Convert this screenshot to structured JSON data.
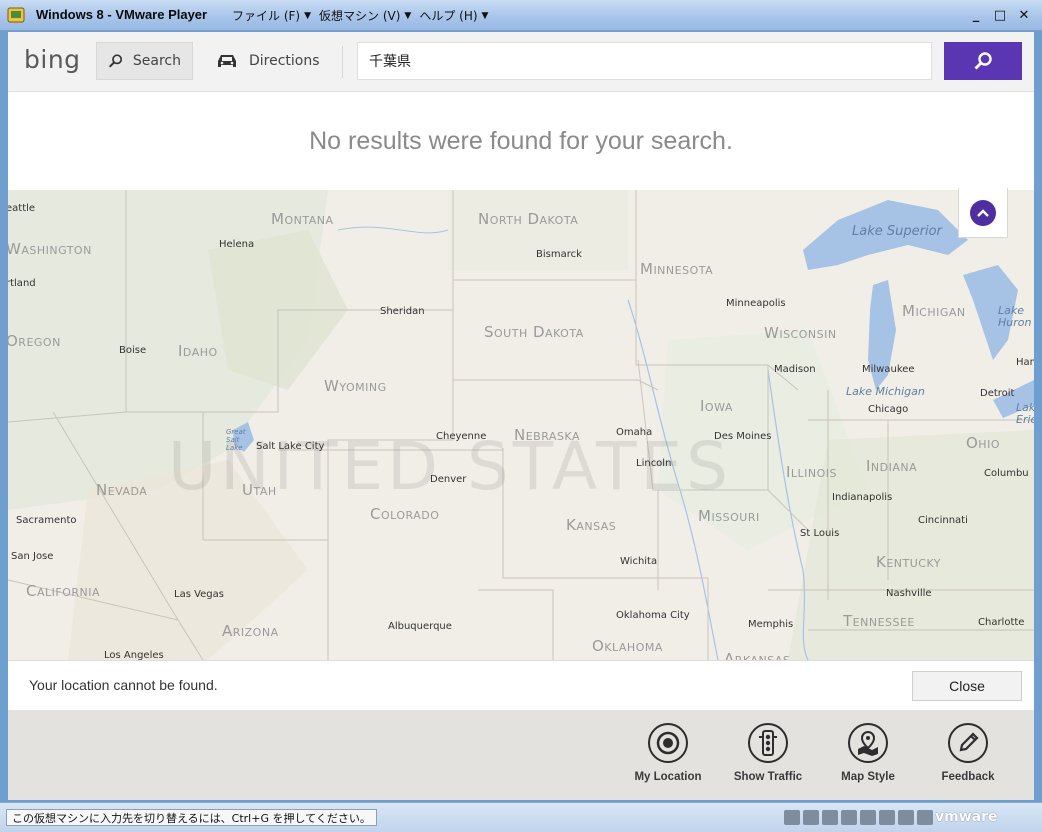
{
  "window": {
    "title": "Windows 8 - VMware Player",
    "menus": [
      "ファイル (F)",
      "仮想マシン (V)",
      "ヘルプ (H)"
    ],
    "controls": {
      "minimize": "_",
      "maximize": "□",
      "close": "✕"
    }
  },
  "app": {
    "logo": "bing",
    "tabs": {
      "search": "Search",
      "directions": "Directions"
    },
    "search": {
      "value": "千葉県",
      "button_icon": "search-icon"
    },
    "no_results": "No results were found for your search.",
    "map": {
      "country_label": "UNITED STATES",
      "states": [
        "Montana",
        "North Dakota",
        "Minnesota",
        "Washington",
        "Idaho",
        "Oregon",
        "South Dakota",
        "Wisconsin",
        "Michigan",
        "Wyoming",
        "Iowa",
        "Nebraska",
        "Nevada",
        "Utah",
        "Colorado",
        "Kansas",
        "Illinois",
        "Indiana",
        "Ohio",
        "Missouri",
        "California",
        "Kentucky",
        "Arizona",
        "Tennessee",
        "Oklahoma",
        "Arkansas"
      ],
      "cities": [
        "eattle",
        "rtland",
        "Helena",
        "Bismarck",
        "Minneapolis",
        "Sheridan",
        "Boise",
        "Madison",
        "Milwaukee",
        "Detroit",
        "Chicago",
        "Salt Lake City",
        "Cheyenne",
        "Omaha",
        "Des Moines",
        "Lincoln",
        "Denver",
        "Indianapolis",
        "Columbu",
        "Cincinnati",
        "Sacramento",
        "San Jose",
        "St Louis",
        "Wichita",
        "Nashville",
        "Las Vegas",
        "Oklahoma City",
        "Memphis",
        "Charlotte",
        "Albuquerque",
        "Hami",
        "Los Angeles"
      ],
      "water": [
        "Lake Superior",
        "Lake Michigan",
        "Lake Huron",
        "Lake Erie",
        "Great Salt Lake"
      ]
    },
    "location_message": "Your location cannot be found.",
    "close_label": "Close",
    "appbar": [
      {
        "label": "My Location",
        "icon": "target-icon"
      },
      {
        "label": "Show Traffic",
        "icon": "traffic-light-icon"
      },
      {
        "label": "Map Style",
        "icon": "map-style-icon"
      },
      {
        "label": "Feedback",
        "icon": "pencil-icon"
      }
    ]
  },
  "statusbar": {
    "hint": "この仮想マシンに入力先を切り替えるには、Ctrl+G を押してください。",
    "brand": "vmware"
  },
  "colors": {
    "accent": "#5b36b3",
    "map_land": "#f1eee8",
    "map_water": "#a6c3e6"
  }
}
